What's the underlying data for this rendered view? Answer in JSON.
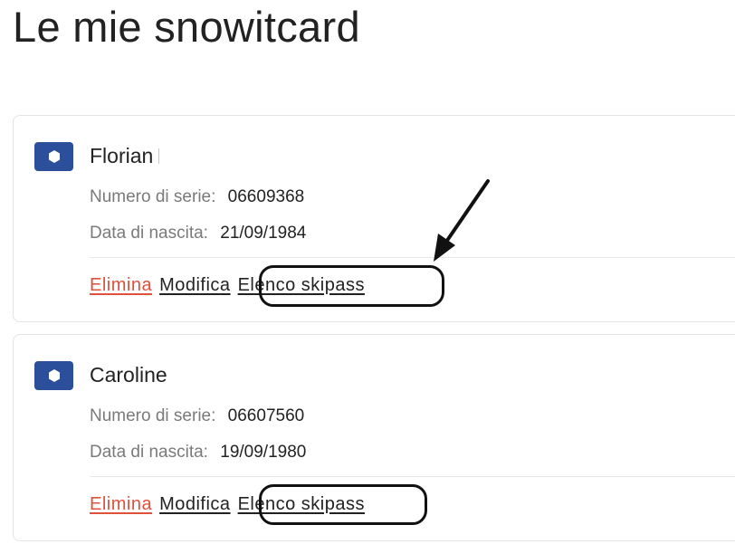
{
  "page": {
    "title": "Le mie snowitcard"
  },
  "colors": {
    "accent": "#2b4f9a",
    "delete": "#e0513c"
  },
  "cards": [
    {
      "icon": "snowcard-icon",
      "name": "Florian",
      "serial_label": "Numero di serie:",
      "serial_value": "06609368",
      "birth_label": "Data di nascita:",
      "birth_value": "21/09/1984",
      "actions": {
        "delete": "Elimina",
        "edit": "Modifica",
        "skipass": "Elenco skipass"
      }
    },
    {
      "icon": "snowcard-icon",
      "name": "Caroline",
      "serial_label": "Numero di serie:",
      "serial_value": "06607560",
      "birth_label": "Data di nascita:",
      "birth_value": "19/09/1980",
      "actions": {
        "delete": "Elimina",
        "edit": "Modifica",
        "skipass": "Elenco skipass"
      }
    }
  ]
}
